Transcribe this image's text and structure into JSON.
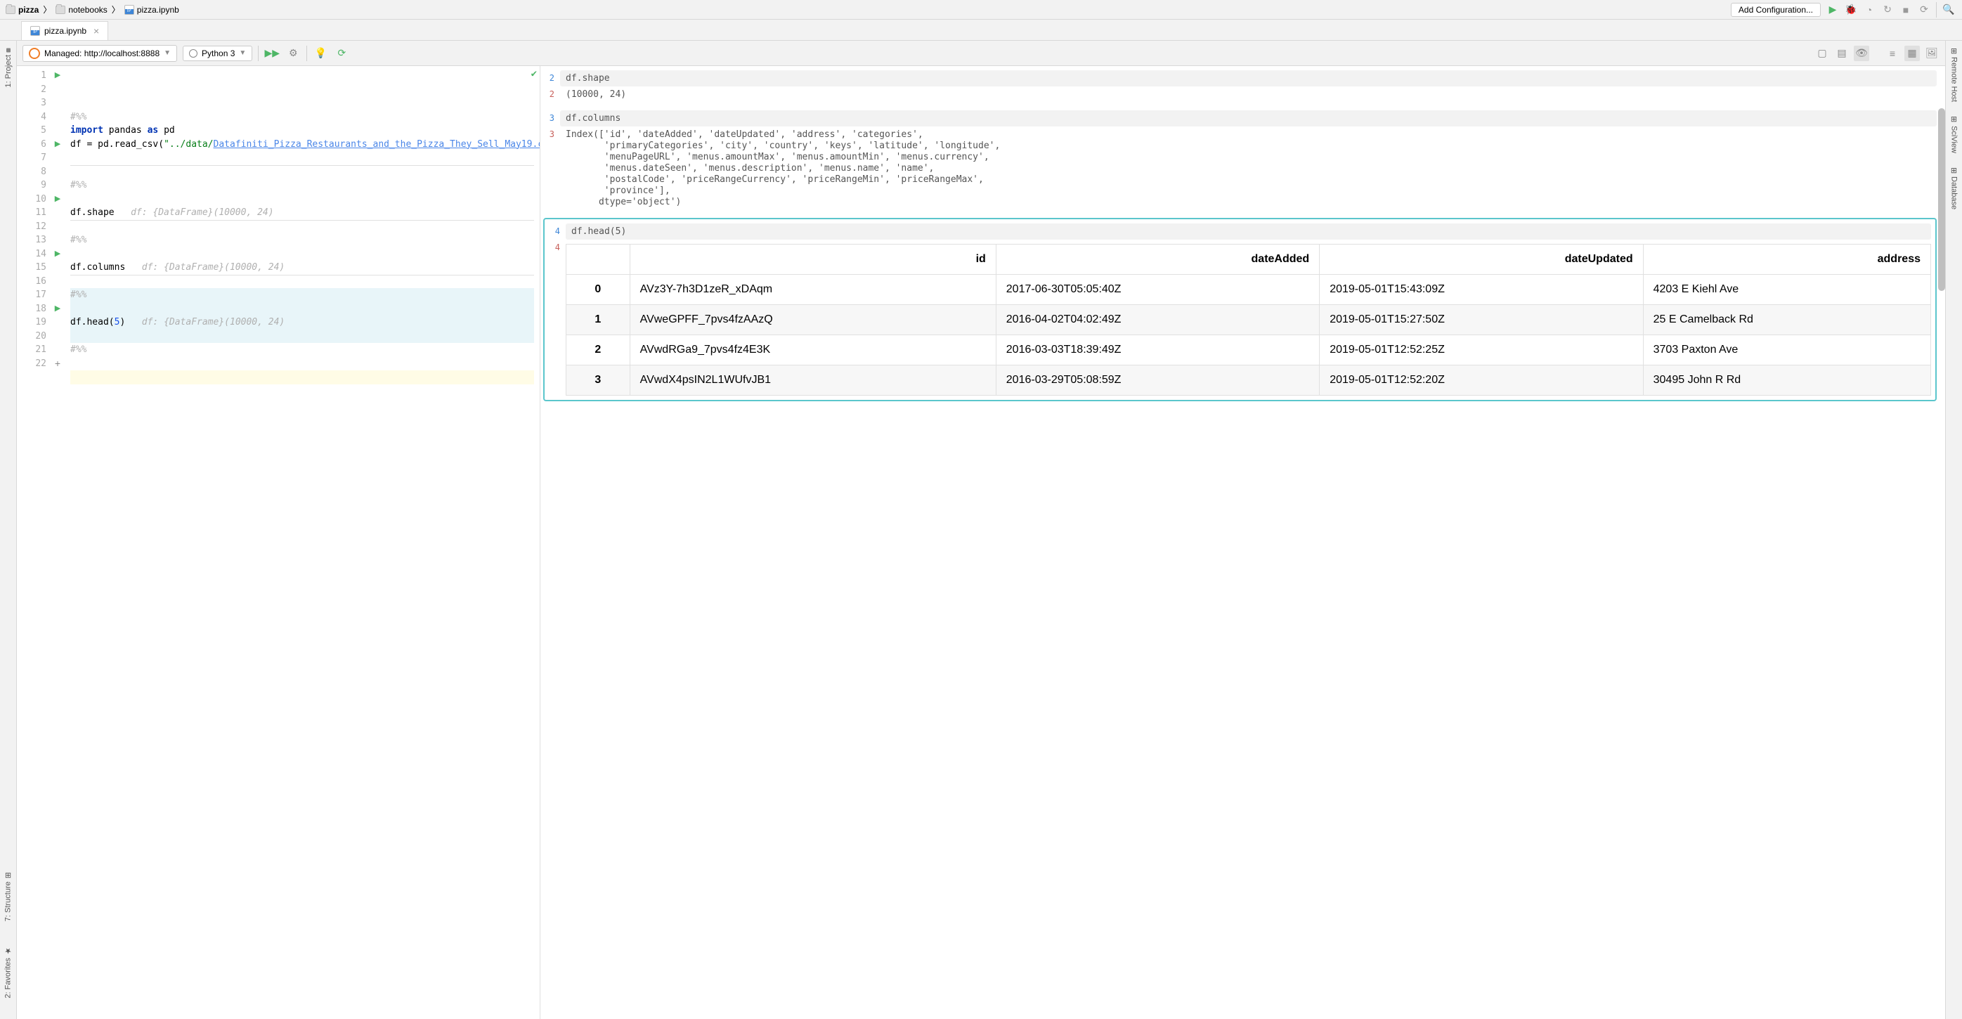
{
  "breadcrumbs": [
    "pizza",
    "notebooks",
    "pizza.ipynb"
  ],
  "add_config_btn": "Add Configuration...",
  "file_tab": "pizza.ipynb",
  "managed_combo": "Managed: http://localhost:8888",
  "kernel_combo": "Python 3",
  "left_tools": {
    "project": "1: Project"
  },
  "bottom_tools": {
    "structure": "7: Structure",
    "favorites": "2: Favorites"
  },
  "right_tools": {
    "remote": "Remote Host",
    "sciview": "SciView",
    "database": "Database"
  },
  "editor": {
    "lines": [
      {
        "n": 1,
        "run": true,
        "type": "cm",
        "code": "#%%"
      },
      {
        "n": 2,
        "type": "code",
        "tokens": [
          "<kw>import</kw> pandas <kw>as</kw> pd"
        ]
      },
      {
        "n": 3,
        "type": "code",
        "tokens": [
          "df = pd.read_csv(<str>\"../data/</str><path>Datafiniti_Pizza_Restaurants_and_the_Pizza_They_Sell_May19.c</path>"
        ]
      },
      {
        "n": 4,
        "type": "blank"
      },
      {
        "n": 5,
        "type": "blank",
        "sep": true
      },
      {
        "n": 6,
        "run": true,
        "type": "cm",
        "code": "#%%"
      },
      {
        "n": 7,
        "type": "blank"
      },
      {
        "n": 8,
        "type": "code",
        "tokens": [
          "df.shape   <hint>df: {DataFrame}(10000, 24)</hint>"
        ]
      },
      {
        "n": 9,
        "type": "blank",
        "sep": true
      },
      {
        "n": 10,
        "run": true,
        "type": "cm",
        "code": "#%%"
      },
      {
        "n": 11,
        "type": "blank"
      },
      {
        "n": 12,
        "type": "code",
        "tokens": [
          "df.columns   <hint>df: {DataFrame}(10000, 24)</hint>"
        ]
      },
      {
        "n": 13,
        "type": "blank",
        "sep": true
      },
      {
        "n": 14,
        "run": true,
        "type": "cm",
        "code": "#%%",
        "hl": true
      },
      {
        "n": 15,
        "type": "blank",
        "hl": true
      },
      {
        "n": 16,
        "type": "code",
        "tokens": [
          "df.head(<num>5</num>)   <hint>df: {DataFrame}(10000, 24)</hint>"
        ],
        "hl": true
      },
      {
        "n": 17,
        "type": "blank",
        "hl": true,
        "sep_after": true
      },
      {
        "n": 18,
        "run": true,
        "type": "cm",
        "code": "#%%"
      },
      {
        "n": 19,
        "type": "blank"
      },
      {
        "n": 20,
        "type": "blank",
        "current": true
      },
      {
        "n": 21,
        "type": "blank"
      },
      {
        "n": 22,
        "type": "add"
      }
    ]
  },
  "output": {
    "cells": [
      {
        "in_n": "2",
        "code": "df.shape",
        "out_n": "2",
        "out": "(10000, 24)"
      },
      {
        "in_n": "3",
        "code": "df.columns",
        "out_n": "3",
        "out": "Index(['id', 'dateAdded', 'dateUpdated', 'address', 'categories',\n       'primaryCategories', 'city', 'country', 'keys', 'latitude', 'longitude',\n       'menuPageURL', 'menus.amountMax', 'menus.amountMin', 'menus.currency',\n       'menus.dateSeen', 'menus.description', 'menus.name', 'name',\n       'postalCode', 'priceRangeCurrency', 'priceRangeMin', 'priceRangeMax',\n       'province'],\n      dtype='object')"
      },
      {
        "in_n": "4",
        "code": "df.head(5)",
        "out_n": "4",
        "out_type": "table",
        "selected": true
      }
    ],
    "table": {
      "columns": [
        "",
        "id",
        "dateAdded",
        "dateUpdated",
        "address"
      ],
      "rows": [
        [
          "0",
          "AVz3Y-7h3D1zeR_xDAqm",
          "2017-06-30T05:05:40Z",
          "2019-05-01T15:43:09Z",
          "4203 E Kiehl Ave"
        ],
        [
          "1",
          "AVweGPFF_7pvs4fzAAzQ",
          "2016-04-02T04:02:49Z",
          "2019-05-01T15:27:50Z",
          "25 E Camelback Rd"
        ],
        [
          "2",
          "AVwdRGa9_7pvs4fz4E3K",
          "2016-03-03T18:39:49Z",
          "2019-05-01T12:52:25Z",
          "3703 Paxton Ave"
        ],
        [
          "3",
          "AVwdX4psIN2L1WUfvJB1",
          "2016-03-29T05:08:59Z",
          "2019-05-01T12:52:20Z",
          "30495 John R Rd"
        ]
      ]
    }
  }
}
